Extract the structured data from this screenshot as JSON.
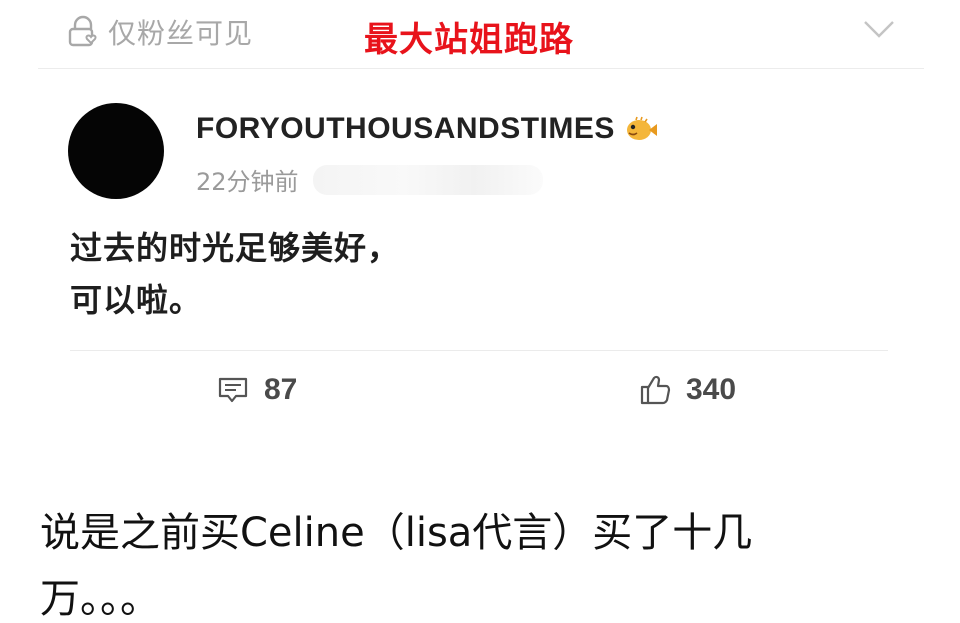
{
  "header": {
    "visibility_label": "仅粉丝可见",
    "overlay_title": "最大站姐跑路",
    "accent_color": "#e8131b"
  },
  "post": {
    "username": "FORYOUTHOUSANDSTIMES",
    "timestamp": "22分钟前",
    "body_lines": [
      "过去的时光足够美好，",
      "可以啦。"
    ],
    "comment_count": "87",
    "like_count": "340",
    "icons": [
      "lock-heart-icon",
      "pufferfish-badge-icon",
      "comment-icon",
      "thumbs-up-icon",
      "chevron-down-icon"
    ]
  },
  "caption": {
    "lines": [
      "说是之前买Celine（lisa代言）买了十几",
      "万。。。"
    ]
  }
}
